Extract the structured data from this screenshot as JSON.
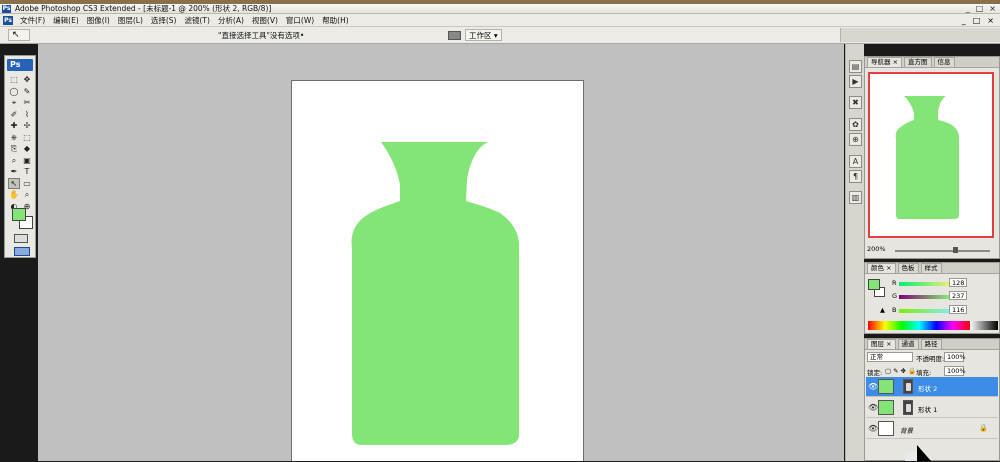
{
  "app": {
    "title": "Adobe Photoshop CS3 Extended - [未标题-1 @ 200% (形状 2, RGB/8)]",
    "logo": "Ps",
    "window_controls": [
      "_",
      "□",
      "×"
    ]
  },
  "menubar": {
    "items": [
      "文件(F)",
      "编辑(E)",
      "图像(I)",
      "图层(L)",
      "选择(S)",
      "滤镜(T)",
      "分析(A)",
      "视图(V)",
      "窗口(W)",
      "帮助(H)"
    ],
    "doc_controls": [
      "_",
      "□",
      "×"
    ]
  },
  "options": {
    "tool_icon": "direct-selection-arrow-icon",
    "tool_glyph": "↖",
    "hint": "\"直接选择工具\"没有选项•",
    "workspace_label": "工作区 ▾"
  },
  "toolbox": {
    "logo": "Ps",
    "tools": [
      "⬚",
      "✥",
      "◯",
      "✎",
      "⌖",
      "✂",
      "✐",
      "⌇",
      "✚",
      "✢",
      "⎈",
      "⬚",
      "⎘",
      "◆",
      "⌕",
      "▣",
      "✒",
      "T",
      "↖",
      "▭",
      "✋",
      "⌕",
      "◐",
      "⊕"
    ],
    "selected_index": 18,
    "foreground_color": "#84e577",
    "background_color": "#ffffff"
  },
  "canvas": {
    "background": "#ffffff",
    "shape_color": "#84e577"
  },
  "navigator": {
    "tabs": [
      "导航器 ×",
      "直方图",
      "信息"
    ],
    "zoom": "200%"
  },
  "color_panel": {
    "tabs": [
      "颜色 ×",
      "色板",
      "样式"
    ],
    "channels": [
      {
        "label": "R",
        "value": "128"
      },
      {
        "label": "G",
        "value": "237"
      },
      {
        "label": "B",
        "value": "116"
      }
    ]
  },
  "layers_panel": {
    "tabs": [
      "图层 ×",
      "通道",
      "路径"
    ],
    "blend_mode": "正常",
    "opacity_label": "不透明度:",
    "opacity": "100%",
    "lock_label": "锁定:",
    "fill_label": "填充:",
    "fill": "100%",
    "layers": [
      {
        "name": "形状 2",
        "selected": true
      },
      {
        "name": "形状 1",
        "selected": false
      },
      {
        "name": "背景",
        "selected": false
      }
    ]
  }
}
